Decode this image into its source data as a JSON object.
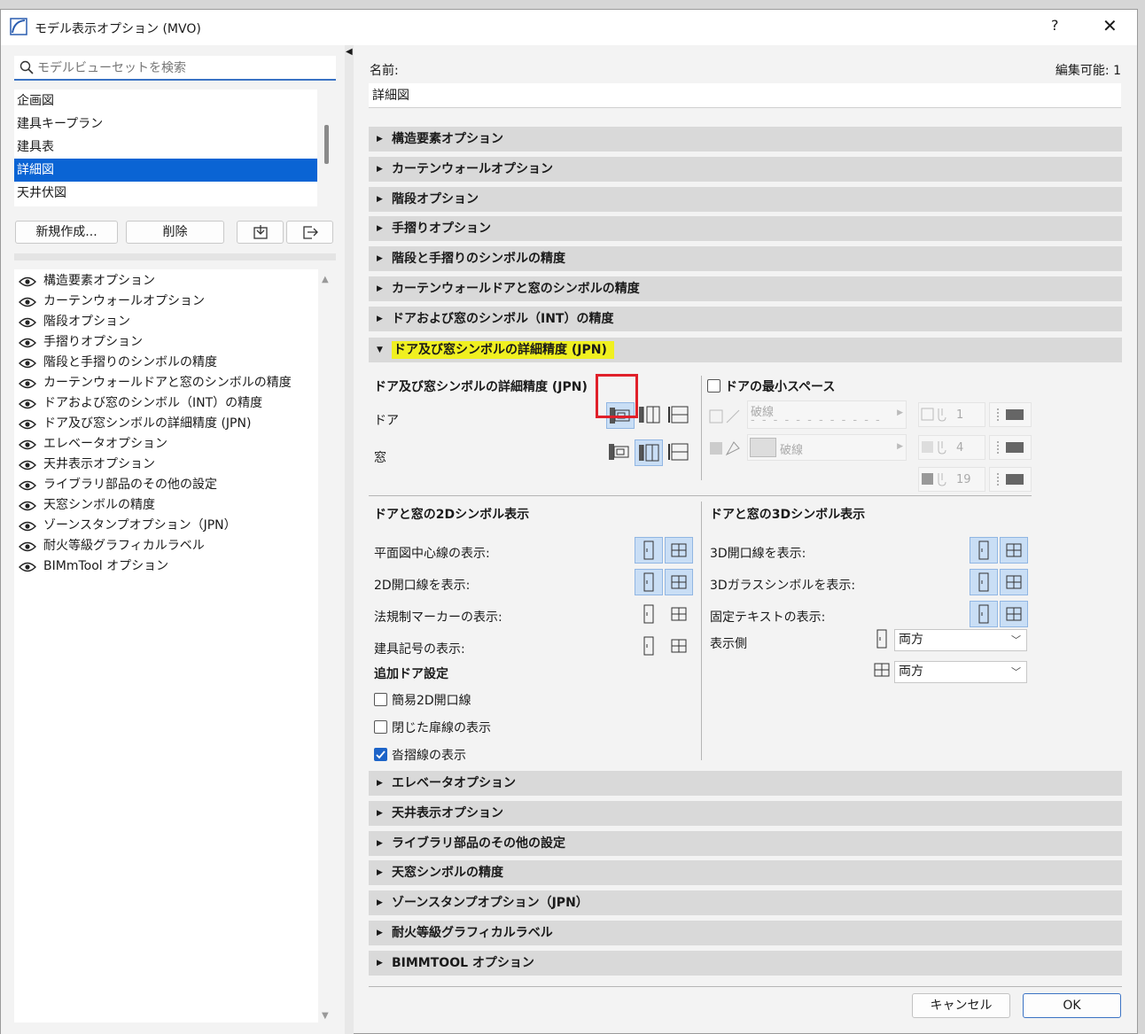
{
  "window": {
    "title": "モデル表示オプション (MVO)",
    "help": "?",
    "close": "✕"
  },
  "search": {
    "placeholder": "モデルビューセットを検索"
  },
  "sets": [
    {
      "label": "企画図"
    },
    {
      "label": "建具キープラン"
    },
    {
      "label": "建具表"
    },
    {
      "label": "詳細図",
      "selected": true
    },
    {
      "label": "天井伏図"
    }
  ],
  "buttons": {
    "new": "新規作成...",
    "delete": "削除",
    "cancel": "キャンセル",
    "ok": "OK"
  },
  "options": [
    "構造要素オプション",
    "カーテンウォールオプション",
    "階段オプション",
    "手摺りオプション",
    "階段と手摺りのシンボルの精度",
    "カーテンウォールドアと窓のシンボルの精度",
    "ドアおよび窓のシンボル（INT）の精度",
    "ドア及び窓シンボルの詳細精度 (JPN)",
    "エレベータオプション",
    "天井表示オプション",
    "ライブラリ部品のその他の設定",
    "天窓シンボルの精度",
    "ゾーンスタンプオプション（JPN）",
    "耐火等級グラフィカルラベル",
    "BIMmTool オプション"
  ],
  "right": {
    "name_label": "名前:",
    "editable": "編集可能: 1",
    "name_value": "詳細図"
  },
  "sections_top": [
    "構造要素オプション",
    "カーテンウォールオプション",
    "階段オプション",
    "手摺りオプション",
    "階段と手摺りのシンボルの精度",
    "カーテンウォールドアと窓のシンボルの精度",
    "ドアおよび窓のシンボル（INT）の精度"
  ],
  "open_section": "ドア及び窓シンボルの詳細精度 (JPN)",
  "sections_bottom": [
    "エレベータオプション",
    "天井表示オプション",
    "ライブラリ部品のその他の設定",
    "天窓シンボルの精度",
    "ゾーンスタンプオプション（JPN）",
    "耐火等級グラフィカルラベル",
    "BIMMTOOL オプション"
  ],
  "panel": {
    "detail_title": "ドア及び窓シンボルの詳細精度 (JPN)",
    "door": "ドア",
    "window": "窓",
    "min_space": "ドアの最小スペース",
    "line_type": "破線",
    "fill_type": "破線",
    "pen1": "1",
    "pen2": "4",
    "pen3": "19",
    "sym2d_title": "ドアと窓の2Dシンボル表示",
    "sym2d": [
      "平面図中心線の表示:",
      "2D開口線を表示:",
      "法規制マーカーの表示:",
      "建具記号の表示:"
    ],
    "sym3d_title": "ドアと窓の3Dシンボル表示",
    "sym3d": [
      "3D開口線を表示:",
      "3Dガラスシンボルを表示:",
      "固定テキストの表示:"
    ],
    "display_side": "表示側",
    "side_door": "両方",
    "side_window": "両方",
    "extra_title": "追加ドア設定",
    "extra": [
      {
        "label": "簡易2D開口線",
        "checked": false
      },
      {
        "label": "閉じた扉線の表示",
        "checked": false
      },
      {
        "label": "沓摺線の表示",
        "checked": true
      }
    ]
  }
}
